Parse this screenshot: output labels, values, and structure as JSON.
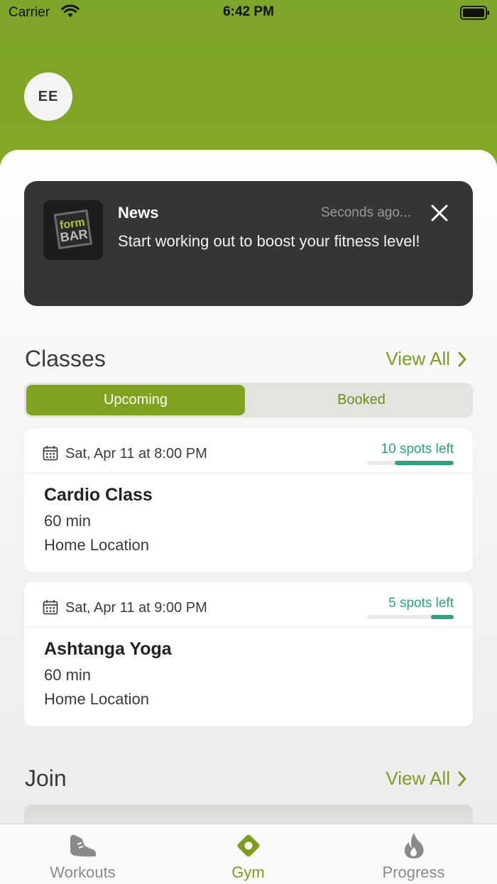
{
  "status_bar": {
    "carrier": "Carrier",
    "time": "6:42 PM"
  },
  "profile": {
    "initials": "EE"
  },
  "notification": {
    "title": "News",
    "time": "Seconds ago...",
    "message": "Start working out to boost your fitness level!",
    "logo_text_top": "form",
    "logo_text_bottom": "BAR"
  },
  "classes": {
    "title": "Classes",
    "view_all": "View All",
    "tabs": {
      "upcoming": "Upcoming",
      "booked": "Booked"
    },
    "items": [
      {
        "date": "Sat, Apr 11 at 8:00 PM",
        "spots": "10 spots left",
        "spots_fraction": 0.68,
        "name": "Cardio Class",
        "duration": "60 min",
        "location": "Home Location"
      },
      {
        "date": "Sat, Apr 11 at 9:00 PM",
        "spots": "5 spots left",
        "spots_fraction": 0.26,
        "name": "Ashtanga Yoga",
        "duration": "60 min",
        "location": "Home Location"
      }
    ]
  },
  "join": {
    "title": "Join",
    "view_all": "View All"
  },
  "tabbar": {
    "workouts": "Workouts",
    "gym": "Gym",
    "progress": "Progress"
  },
  "colors": {
    "brand_green": "#7fa31f",
    "accent_teal": "#2fa283",
    "notification_bg": "#353535"
  }
}
